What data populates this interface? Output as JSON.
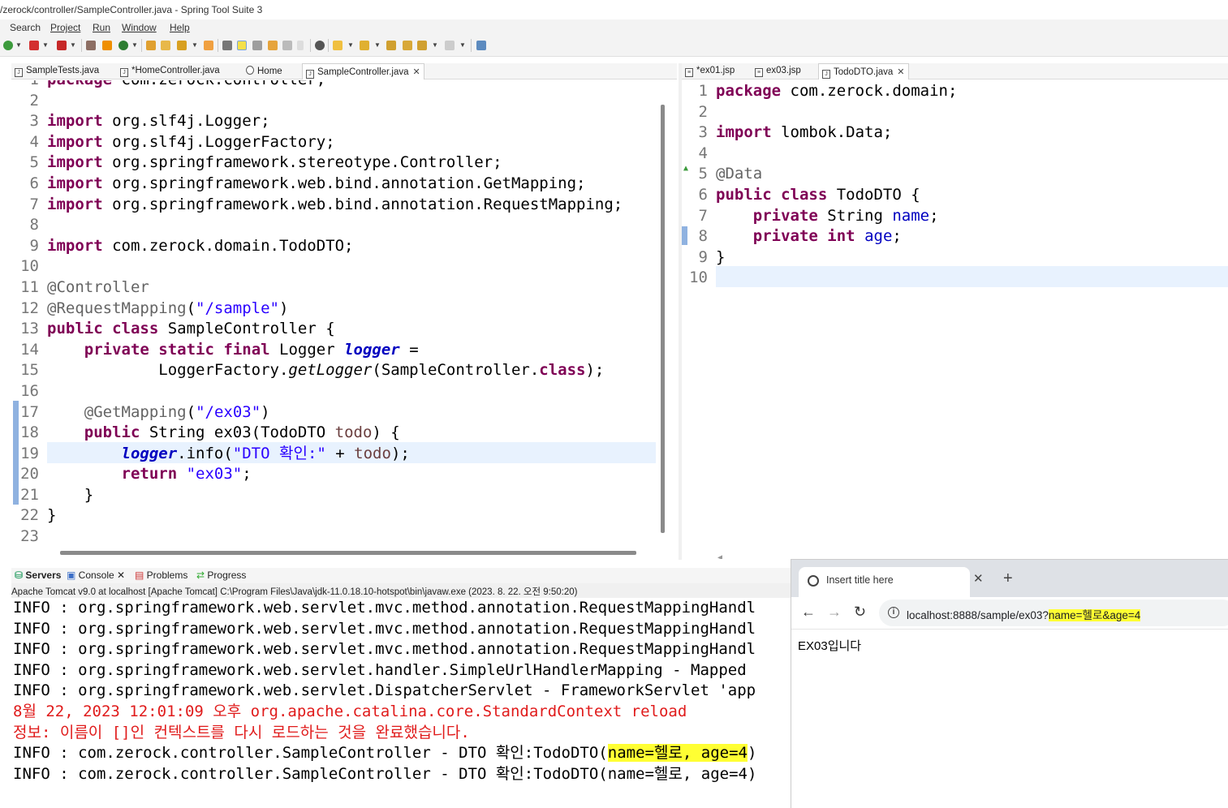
{
  "window": {
    "title": "/zerock/controller/SampleController.java - Spring Tool Suite 3"
  },
  "menu": [
    "Search",
    "Project",
    "Run",
    "Window",
    "Help"
  ],
  "left_editor": {
    "tabs": [
      {
        "label": "SampleTests.java",
        "active": false,
        "closable": false
      },
      {
        "label": "*HomeController.java",
        "active": false,
        "closable": false
      },
      {
        "label": "Home",
        "active": false,
        "closable": false
      },
      {
        "label": "SampleController.java",
        "active": true,
        "closable": true
      }
    ],
    "line_numbers": [
      "1",
      "2",
      "3",
      "4",
      "5",
      "6",
      "7",
      "8",
      "9",
      "10",
      "11",
      "12",
      "13",
      "14",
      "15",
      "16",
      "17",
      "18",
      "19",
      "20",
      "21",
      "22",
      "23"
    ],
    "current_line": 19,
    "partial_first_line": "package com.zerock.controller;"
  },
  "right_editor": {
    "tabs": [
      {
        "label": "*ex01.jsp",
        "active": false,
        "closable": false
      },
      {
        "label": "ex03.jsp",
        "active": false,
        "closable": false
      },
      {
        "label": "TodoDTO.java",
        "active": true,
        "closable": true
      }
    ],
    "line_numbers": [
      "1",
      "2",
      "3",
      "4",
      "5",
      "6",
      "7",
      "8",
      "9",
      "10"
    ],
    "current_line": 10
  },
  "bottom_panel": {
    "tabs": [
      {
        "label": "Servers",
        "active": true
      },
      {
        "label": "Console",
        "active": false
      },
      {
        "label": "Problems",
        "active": false
      },
      {
        "label": "Progress",
        "active": false
      }
    ],
    "console_header": "Apache Tomcat v9.0  at localhost [Apache Tomcat] C:\\Program Files\\Java\\jdk-11.0.18.10-hotspot\\bin\\javaw.exe  (2023. 8. 22. 오전 9:50:20)",
    "lines": [
      {
        "text": "INFO : org.springframework.web.servlet.mvc.method.annotation.RequestMappingHandl",
        "color": "black"
      },
      {
        "text": "INFO : org.springframework.web.servlet.mvc.method.annotation.RequestMappingHandl",
        "color": "black"
      },
      {
        "text": "INFO : org.springframework.web.servlet.mvc.method.annotation.RequestMappingHandl",
        "color": "black"
      },
      {
        "text": "INFO : org.springframework.web.servlet.handler.SimpleUrlHandlerMapping - Mapped",
        "color": "black"
      },
      {
        "text": "INFO : org.springframework.web.servlet.DispatcherServlet - FrameworkServlet 'app",
        "color": "black"
      },
      {
        "text": "8월 22, 2023 12:01:09 오후 org.apache.catalina.core.StandardContext reload",
        "color": "red"
      },
      {
        "text": "정보: 이름이 []인 컨텍스트를 다시 로드하는 것을 완료했습니다.",
        "color": "red"
      },
      {
        "text": "INFO : com.zerock.controller.SampleController - DTO 확인:TodoDTO(",
        "highlight": "name=헬로, age=4",
        "after": ")",
        "color": "black"
      },
      {
        "text": "INFO : com.zerock.controller.SampleController - DTO 확인:TodoDTO(name=헬로, age=4)",
        "color": "black"
      }
    ]
  },
  "browser": {
    "tab_title": "Insert title here",
    "url_plain": "localhost:8888/sample/ex03?",
    "url_highlight": "name=헬로&age=4",
    "page_text": "EX03입니다",
    "highlight_color": "#ffff33"
  },
  "icons": [
    "java-file-icon",
    "jsp-file-icon",
    "globe-icon",
    "close-icon",
    "back-icon",
    "forward-icon",
    "reload-icon",
    "info-icon",
    "new-tab-icon",
    "servers-icon",
    "console-icon",
    "problems-icon",
    "progress-icon"
  ],
  "colors": {
    "keyword": "#7f0055",
    "string": "#2a00ff",
    "annotation": "#646464",
    "field": "#0000c0",
    "console_error": "#e01b1b",
    "current_line": "#e8f2fe"
  }
}
